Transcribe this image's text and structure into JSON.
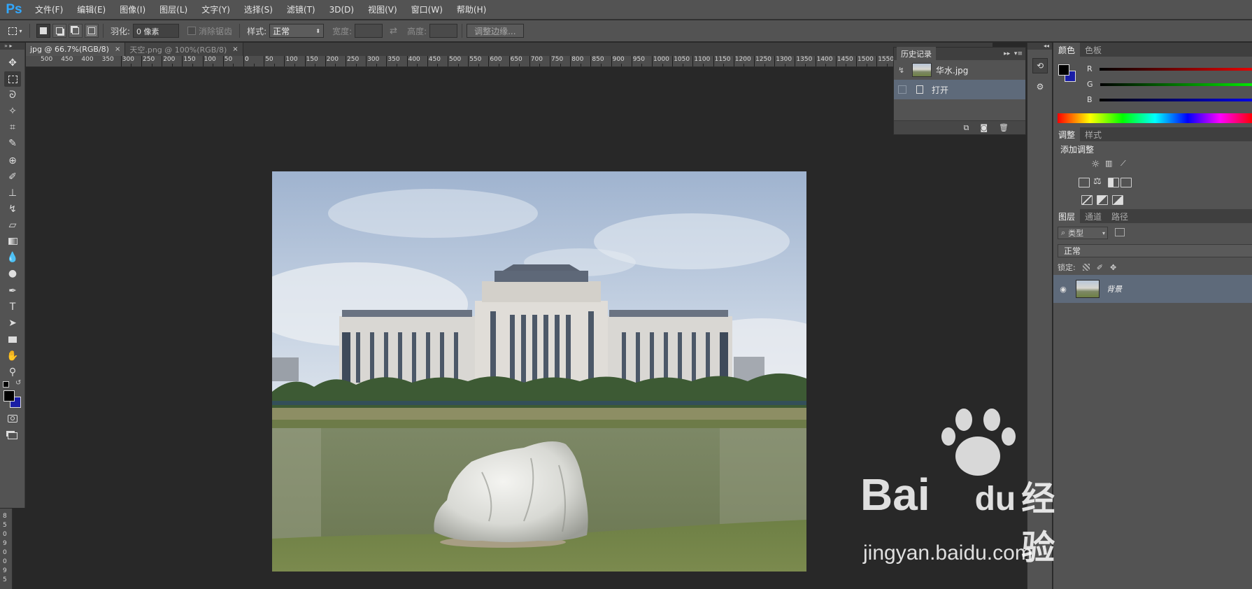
{
  "app": {
    "logo": "Ps"
  },
  "menubar": {
    "items": [
      "文件(F)",
      "编辑(E)",
      "图像(I)",
      "图层(L)",
      "文字(Y)",
      "选择(S)",
      "滤镜(T)",
      "3D(D)",
      "视图(V)",
      "窗口(W)",
      "帮助(H)"
    ]
  },
  "options": {
    "feather_label": "羽化:",
    "feather_value": "0 像素",
    "antialias_label": "消除锯齿",
    "style_label": "样式:",
    "style_value": "正常",
    "width_label": "宽度:",
    "height_label": "高度:",
    "refine_edge_button": "调整边缘..."
  },
  "doc_tabs": [
    {
      "label": "jpg @ 66.7%(RGB/8)",
      "close": "×",
      "active": true
    },
    {
      "label": "天空.png @ 100%(RGB/8)",
      "close": "×",
      "active": false
    }
  ],
  "ruler": {
    "labels": [
      "0",
      "50",
      "100",
      "150",
      "200",
      "250",
      "300",
      "350",
      "400",
      "450",
      "500",
      "550",
      "600",
      "650",
      "700",
      "750",
      "800",
      "850",
      "900",
      "950",
      "1000",
      "1050",
      "1100",
      "1150",
      "1200",
      "1250",
      "1300",
      "1350",
      "1400",
      "1450",
      "1500",
      "1550"
    ]
  },
  "vruler_labels": [
    "8",
    "5",
    "0",
    "9",
    "0",
    "0",
    "9",
    "5"
  ],
  "history": {
    "panel_title": "历史记录",
    "snapshot_name": "华水.jpg",
    "steps": [
      {
        "label": "打开",
        "selected": true
      }
    ]
  },
  "color_panel": {
    "tabs": [
      "颜色",
      "色板"
    ],
    "channels": [
      "R",
      "G",
      "B"
    ],
    "foreground": "#000000",
    "background": "#1a1ea6"
  },
  "adjust_panel": {
    "tabs": [
      "调整",
      "样式"
    ],
    "title": "添加调整"
  },
  "layers_panel": {
    "tabs": [
      "图层",
      "通道",
      "路径"
    ],
    "filter_label": "类型",
    "blend_mode": "正常",
    "lock_label": "锁定:",
    "layers": [
      {
        "name": "背景",
        "visible": true
      }
    ]
  },
  "watermark": {
    "brand": "Bai",
    "brand2": "du",
    "suffix": "经验",
    "url": "jingyan.baidu.com"
  }
}
